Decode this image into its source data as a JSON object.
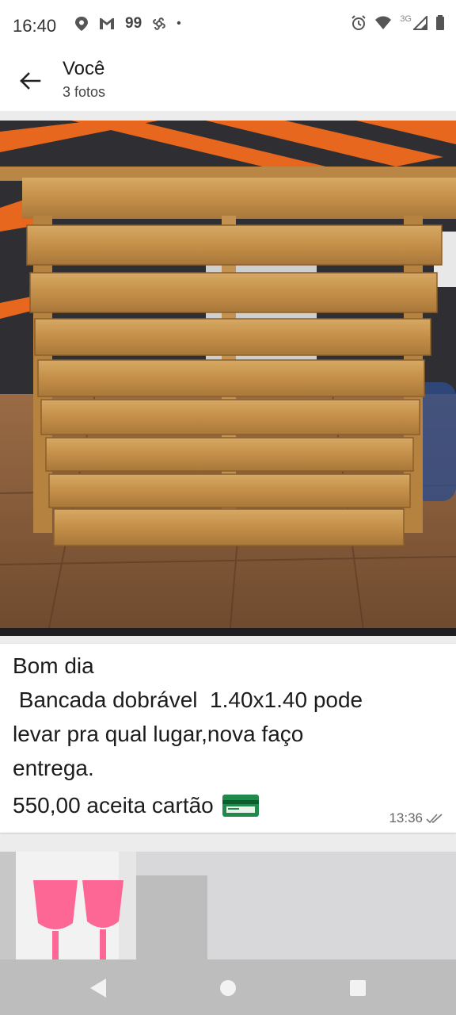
{
  "status_bar": {
    "time": "16:40",
    "badge_number": "99",
    "network_label": "3G"
  },
  "header": {
    "title": "Você",
    "subtitle": "3 fotos"
  },
  "photo": {
    "description_icon": "wooden-folding-counter-photo"
  },
  "caption": {
    "line1": "Bom dia",
    "line2": " Bancada dobrável  1.40x1.40 pode",
    "line3": "levar pra qual lugar,nova faço",
    "line4": "entrega.",
    "price_line": "550,00 aceita cartão",
    "time": "13:36"
  },
  "colors": {
    "accent_green": "#1f8a4c",
    "wood": "#c89a55",
    "stripe_orange": "#e8671e"
  }
}
